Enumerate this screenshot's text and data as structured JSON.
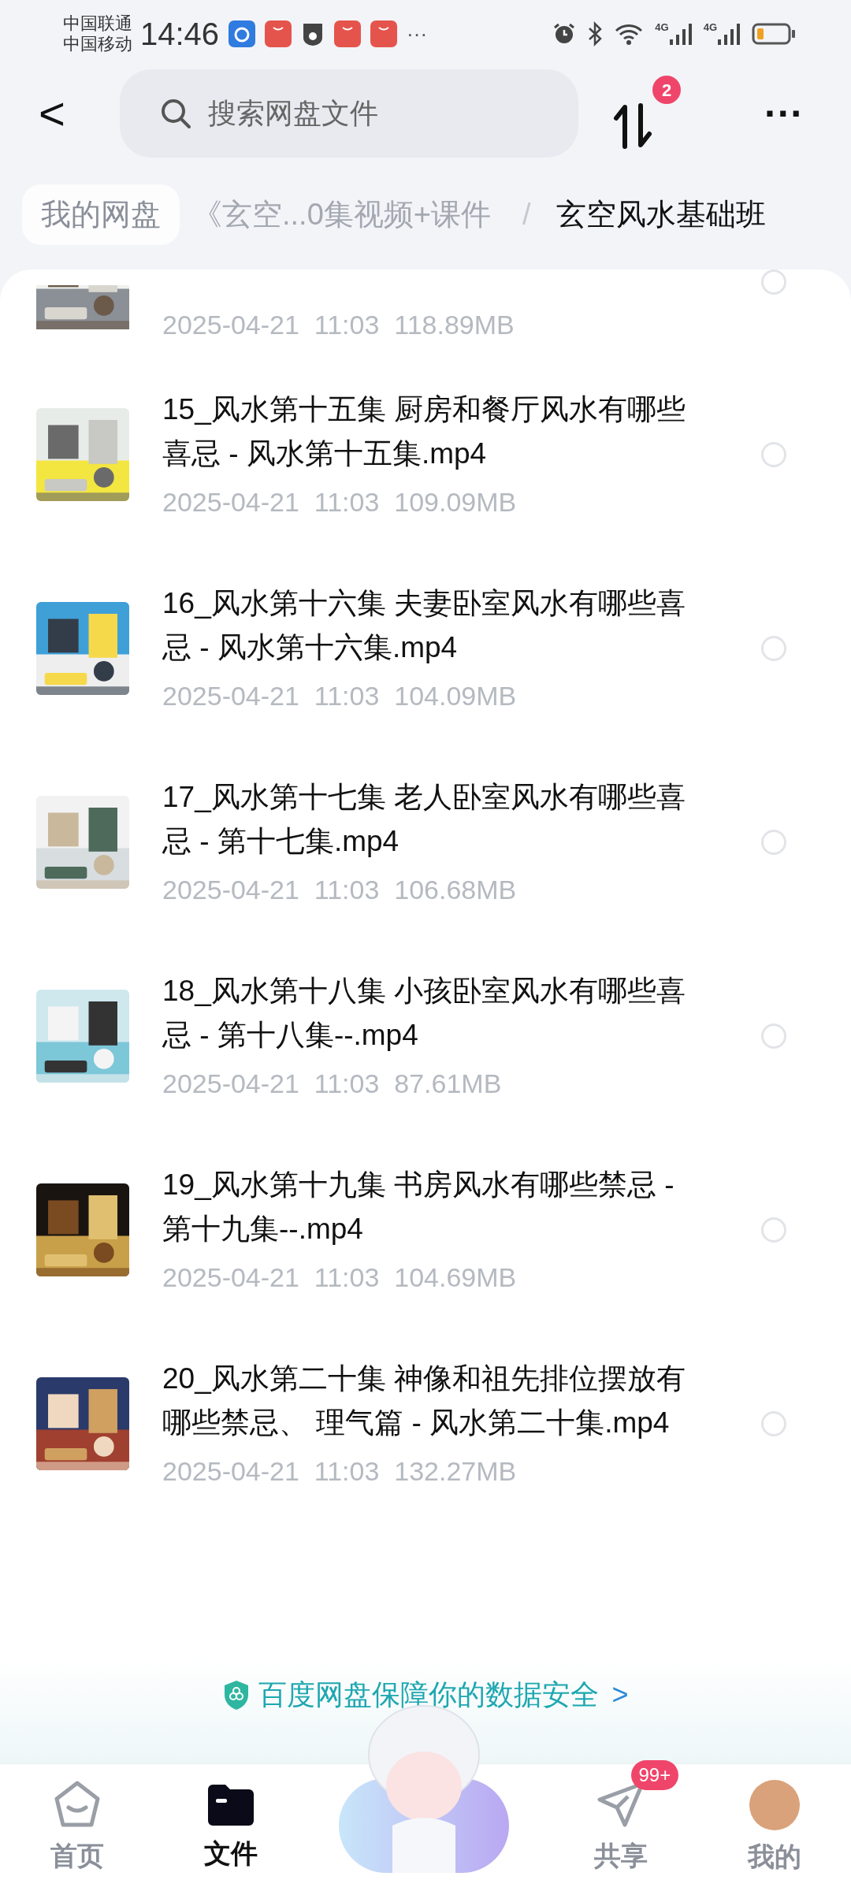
{
  "status_bar": {
    "carriers": [
      "中国联通",
      "中国移动"
    ],
    "time": "14:46",
    "more": "···",
    "networks": [
      "4G",
      "4G"
    ]
  },
  "header": {
    "back": "<",
    "search": {
      "placeholder": "搜索网盘文件"
    },
    "transfer_badge": "2",
    "more": "···"
  },
  "breadcrumb": [
    {
      "label": "我的网盘",
      "current": false
    },
    {
      "label": "《玄空...0集视频+课件",
      "current": false
    },
    {
      "label": "玄空风水基础班",
      "current": true
    }
  ],
  "breadcrumb_separator": "/",
  "partial_file": {
    "meta": "2025-04-21  11:03  118.89MB",
    "selected": false
  },
  "files": [
    {
      "name": "15_风水第十五集 厨房和餐厅风水有哪些喜忌 - 风水第十五集.mp4",
      "meta": "2025-04-21  11:03  109.09MB",
      "selected": false
    },
    {
      "name": "16_风水第十六集 夫妻卧室风水有哪些喜忌 - 风水第十六集.mp4",
      "meta": "2025-04-21  11:03  104.09MB",
      "selected": false
    },
    {
      "name": "17_风水第十七集 老人卧室风水有哪些喜忌 - 第十七集.mp4",
      "meta": "2025-04-21  11:03  106.68MB",
      "selected": false
    },
    {
      "name": "18_风水第十八集 小孩卧室风水有哪些喜忌 - 第十八集--.mp4",
      "meta": "2025-04-21  11:03  87.61MB",
      "selected": false
    },
    {
      "name": "19_风水第十九集 书房风水有哪些禁忌 - 第十九集--.mp4",
      "meta": "2025-04-21  11:03  104.69MB",
      "selected": false
    },
    {
      "name": "20_风水第二十集 神像和祖先排位摆放有哪些禁忌、 理气篇 - 风水第二十集.mp4",
      "meta": "2025-04-21  11:03  132.27MB",
      "selected": false
    }
  ],
  "banner": {
    "text": "百度网盘保障你的数据安全",
    "arrow": ">"
  },
  "tabs": [
    {
      "label": "首页",
      "selected": false,
      "kind": "home"
    },
    {
      "label": "文件",
      "selected": true,
      "kind": "files"
    },
    {
      "kind": "mascot",
      "selected": false
    },
    {
      "label": "共享",
      "selected": false,
      "kind": "share",
      "badge": "99+"
    },
    {
      "label": "我的",
      "selected": false,
      "kind": "me"
    }
  ]
}
